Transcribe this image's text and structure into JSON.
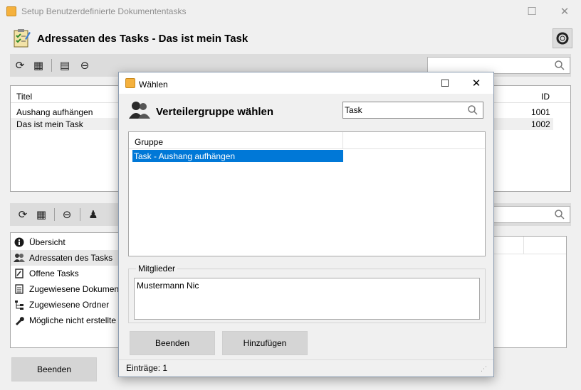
{
  "window": {
    "title": "Setup Benutzerdefinierte Dokumententasks",
    "header_title": "Adressaten des Tasks - Das ist mein Task"
  },
  "top_table": {
    "columns": [
      "Titel",
      "ID"
    ],
    "rows": [
      {
        "titel": "Aushang aufhängen",
        "id": "1001"
      },
      {
        "titel": "Das ist mein Task",
        "id": "1002"
      }
    ]
  },
  "nav": {
    "items": [
      {
        "label": "Übersicht",
        "icon": "info-icon"
      },
      {
        "label": "Adressaten des Tasks",
        "icon": "users-icon"
      },
      {
        "label": "Offene Tasks",
        "icon": "task-icon"
      },
      {
        "label": "Zugewiesene Dokument",
        "icon": "document-icon"
      },
      {
        "label": "Zugewiesene Ordner",
        "icon": "tree-icon"
      },
      {
        "label": "Mögliche nicht erstellte T",
        "icon": "wrench-icon"
      }
    ]
  },
  "main_buttons": {
    "beenden": "Beenden"
  },
  "dialog": {
    "title": "Wählen",
    "heading": "Verteilergruppe wählen",
    "search_value": "Task",
    "group_column": "Gruppe",
    "groups": [
      "Task - Aushang aufhängen"
    ],
    "members_label": "Mitglieder",
    "members": [
      "Mustermann Nic"
    ],
    "btn_beenden": "Beenden",
    "btn_hinzufuegen": "Hinzufügen",
    "status": "Einträge: 1"
  },
  "colors": {
    "selection": "#0078d7",
    "toolbar": "#dcdcdc",
    "background": "#f0f0f0"
  }
}
